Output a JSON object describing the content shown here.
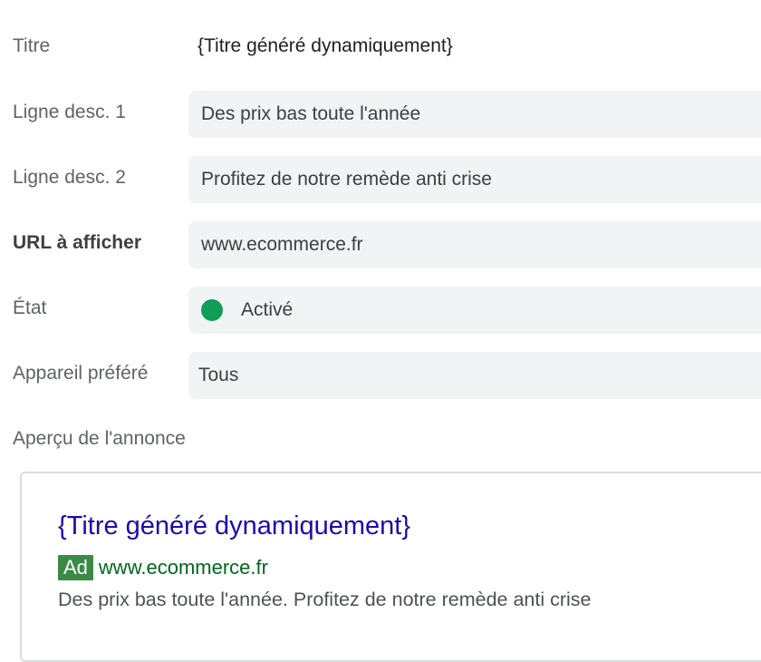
{
  "fields": {
    "title": {
      "label": "Titre",
      "value": "{Titre généré dynamiquement}"
    },
    "desc1": {
      "label": "Ligne desc. 1",
      "value": "Des prix bas toute l'année"
    },
    "desc2": {
      "label": "Ligne desc. 2",
      "value": "Profitez de notre remède anti crise"
    },
    "display_url": {
      "label": "URL à afficher",
      "value": "www.ecommerce.fr"
    },
    "status": {
      "label": "État",
      "value": "Activé",
      "color": "#0f9d58"
    },
    "device": {
      "label": "Appareil préféré",
      "value": "Tous"
    }
  },
  "preview": {
    "label": "Aperçu de l'annonce",
    "headline": "{Titre généré dynamiquement}",
    "badge": "Ad",
    "url": "www.ecommerce.fr",
    "description": "Des prix bas toute l'année. Profitez de notre remède anti crise"
  },
  "colors": {
    "field_bg": "#f1f3f4",
    "headline_link": "#1a0dab",
    "ad_url": "#006621",
    "ad_badge": "#3b8a46"
  }
}
